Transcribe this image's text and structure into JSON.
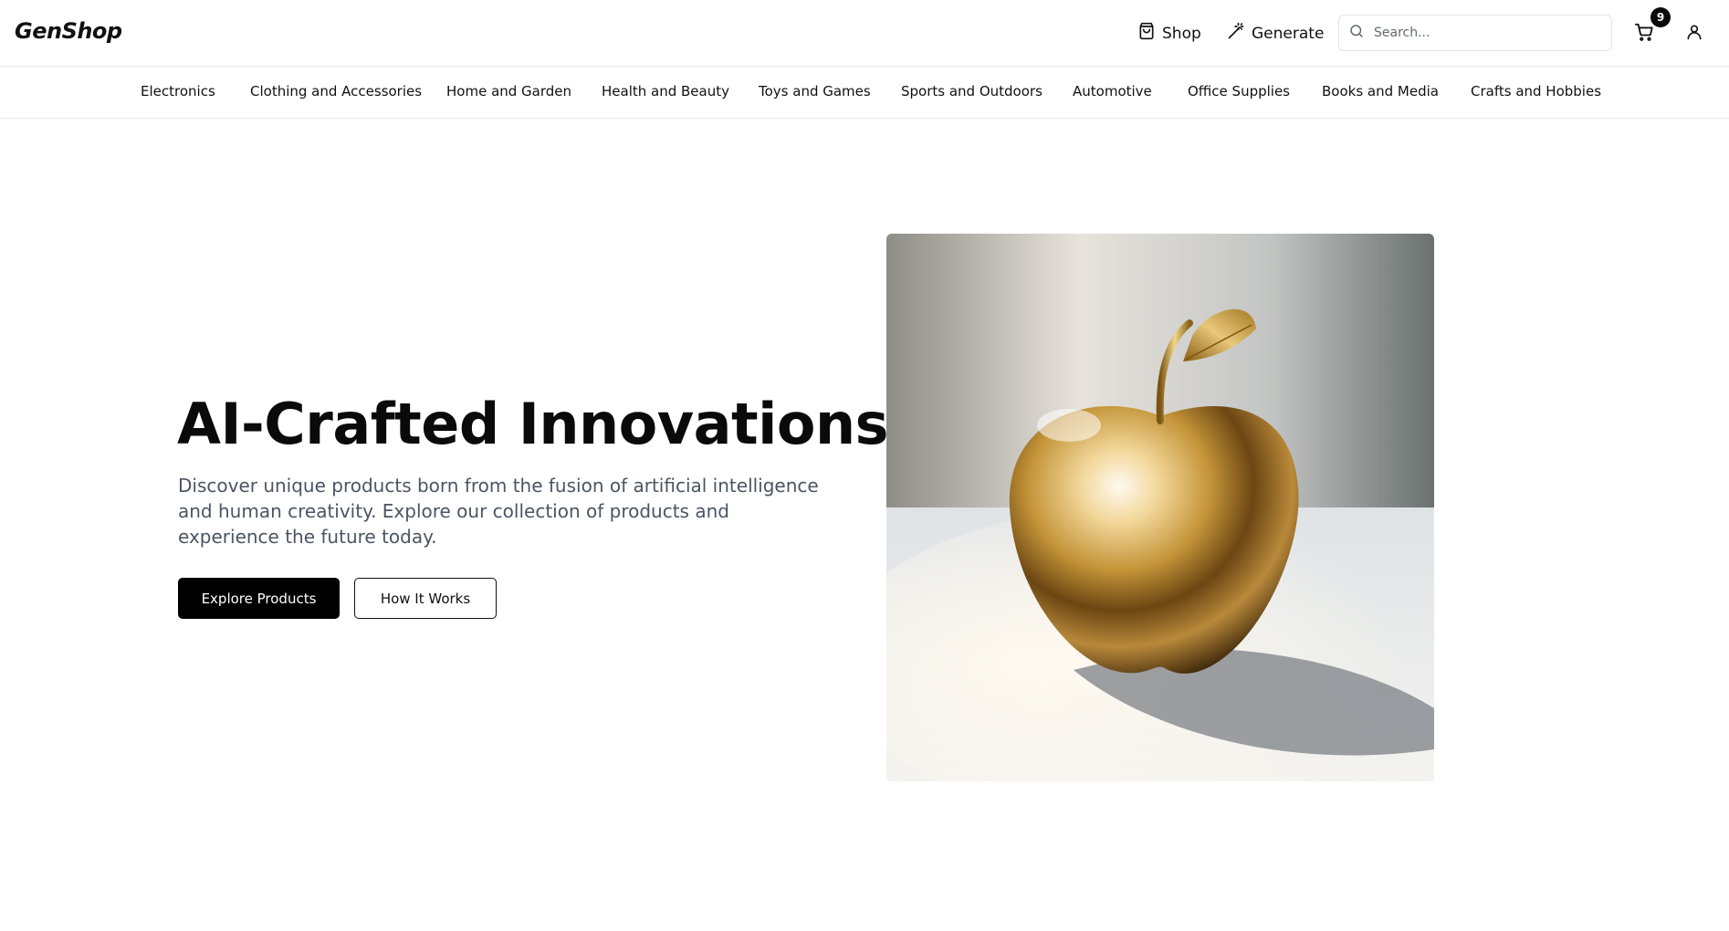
{
  "header": {
    "logo": "GenShop",
    "nav": [
      {
        "label": "Shop",
        "icon": "shopping-bag-icon"
      },
      {
        "label": "Generate",
        "icon": "magic-wand-icon"
      }
    ],
    "search": {
      "placeholder": "Search...",
      "value": ""
    },
    "cart": {
      "count": "9",
      "icon": "cart-icon"
    },
    "user": {
      "icon": "user-icon"
    }
  },
  "categories": [
    "Electronics",
    "Clothing and Accessories",
    "Home and Garden",
    "Health and Beauty",
    "Toys and Games",
    "Sports and Outdoors",
    "Automotive",
    "Office Supplies",
    "Books and Media",
    "Crafts and Hobbies"
  ],
  "hero": {
    "title": "AI-Crafted Innovations",
    "description": "Discover unique products born from the fusion of artificial intelligence and human creativity. Explore our collection of products and experience the future today.",
    "primary_button": "Explore Products",
    "secondary_button": "How It Works",
    "image": "golden-apple-image"
  },
  "colors": {
    "primary_button_bg": "#000000",
    "text": "#111111",
    "muted_text": "#4b5563",
    "border": "#e5e7eb"
  }
}
